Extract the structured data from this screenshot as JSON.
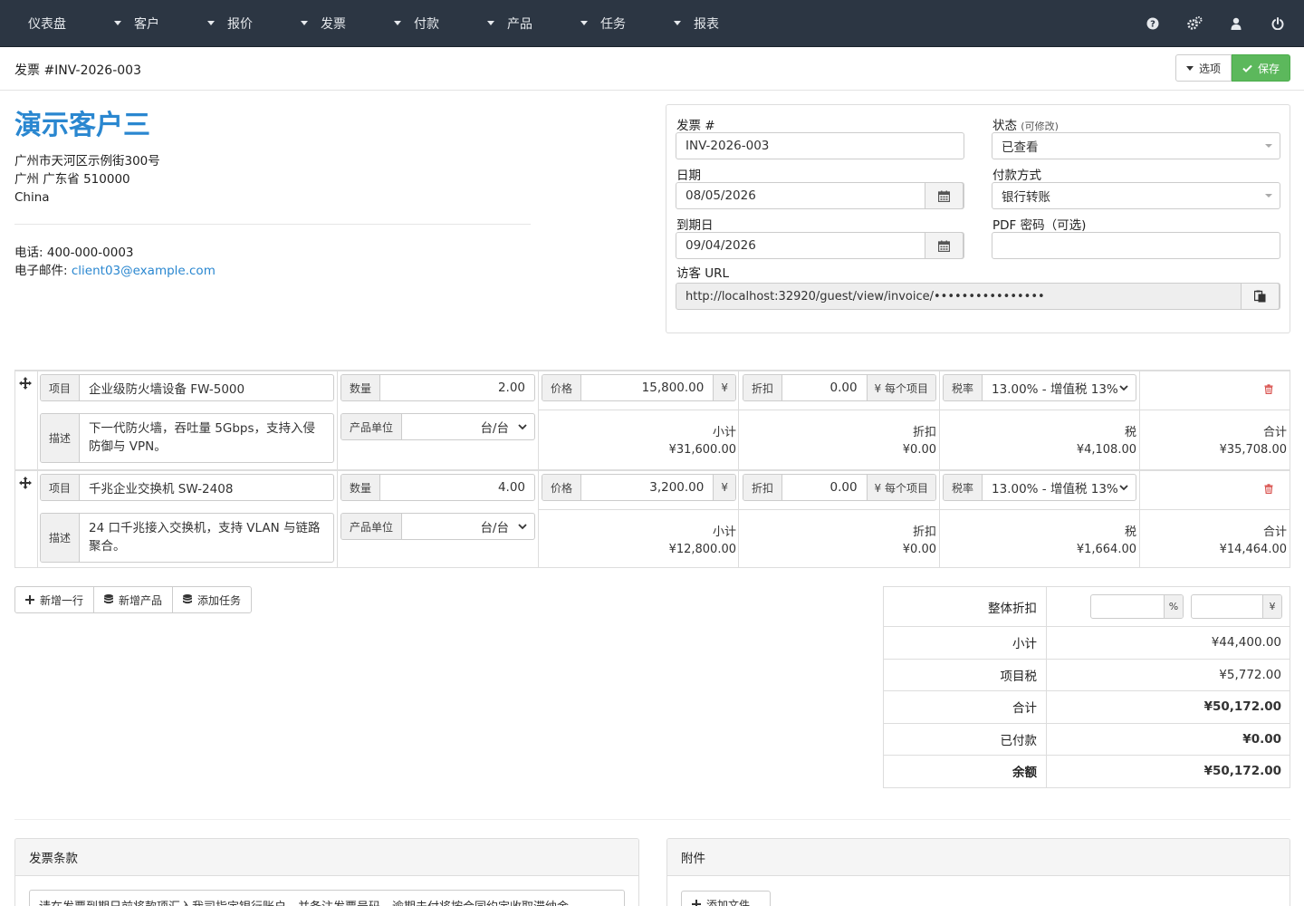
{
  "nav": {
    "items": [
      {
        "label": "仪表盘",
        "has_caret": false
      },
      {
        "label": "客户",
        "has_caret": true
      },
      {
        "label": "报价",
        "has_caret": true
      },
      {
        "label": "发票",
        "has_caret": true
      },
      {
        "label": "付款",
        "has_caret": true
      },
      {
        "label": "产品",
        "has_caret": true
      },
      {
        "label": "任务",
        "has_caret": true
      },
      {
        "label": "报表",
        "has_caret": true
      }
    ],
    "icons": [
      "question-icon",
      "cogs-icon",
      "user-icon",
      "power-icon"
    ],
    "bg_color": "#2c3643"
  },
  "header": {
    "title": "发票 #INV-2026-003",
    "options_label": "选项",
    "save_label": "保存"
  },
  "client": {
    "name": "演示客户三",
    "address_line1": "广州市天河区示例街300号",
    "address_line2": "广州 广东省 510000",
    "country": "China",
    "phone_label": "电话:",
    "phone": "400-000-0003",
    "email_label": "电子邮件:",
    "email": "client03@example.com"
  },
  "props": {
    "invoice_no_label": "发票 #",
    "invoice_no": "INV-2026-003",
    "date_label": "日期",
    "date": "08/05/2026",
    "due_label": "到期日",
    "due": "09/04/2026",
    "status_label": "状态",
    "status_hint": "(可修改)",
    "status": "已查看",
    "payment_label": "付款方式",
    "payment": "银行转账",
    "pdf_label": "PDF 密码（可选)",
    "pdf_password": "",
    "guest_label": "访客 URL",
    "guest_url": "http://localhost:32920/guest/view/invoice/••••••••••••••••"
  },
  "labels": {
    "item": "项目",
    "qty": "数量",
    "price": "价格",
    "discount": "折扣",
    "per_item": "¥ 每个项目",
    "tax_rate": "税率",
    "description": "描述",
    "unit": "产品单位",
    "subtotal": "小计",
    "disc_total": "折扣",
    "tax": "税",
    "total": "合计",
    "currency": "¥"
  },
  "items": [
    {
      "name": "企业级防火墙设备 FW-5000",
      "qty": "2.00",
      "price": "15,800.00",
      "discount": "0.00",
      "tax_rate": "13.00% - 增值税 13%",
      "description": "下一代防火墙，吞吐量 5Gbps，支持入侵防御与 VPN。",
      "unit": "台/台",
      "subtotal": "¥31,600.00",
      "disc": "¥0.00",
      "tax": "¥4,108.00",
      "total": "¥35,708.00"
    },
    {
      "name": "千兆企业交换机 SW-2408",
      "qty": "4.00",
      "price": "3,200.00",
      "discount": "0.00",
      "tax_rate": "13.00% - 增值税 13%",
      "description": "24 口千兆接入交换机，支持 VLAN 与链路聚合。",
      "unit": "台/台",
      "subtotal": "¥12,800.00",
      "disc": "¥0.00",
      "tax": "¥1,664.00",
      "total": "¥14,464.00"
    }
  ],
  "actions": {
    "add_row": "新增一行",
    "add_product": "新增产品",
    "add_task": "添加任务"
  },
  "totals": {
    "overall_discount_label": "整体折扣",
    "percent_suffix": "%",
    "currency_suffix": "¥",
    "subtotal_label": "小计",
    "subtotal": "¥44,400.00",
    "item_tax_label": "项目税",
    "item_tax": "¥5,772.00",
    "total_label": "合计",
    "total": "¥50,172.00",
    "paid_label": "已付款",
    "paid": "¥0.00",
    "balance_label": "余额",
    "balance": "¥50,172.00"
  },
  "terms": {
    "title": "发票条款",
    "text": "请在发票到期日前将款项汇入我司指定银行账户，并备注发票号码。逾期未付将按合同约定收取滞纳金。"
  },
  "attachments": {
    "title": "附件",
    "add_file": "添加文件..."
  },
  "colors": {
    "accent": "#2a87d0",
    "save": "#5cb85c",
    "danger": "#d9534f"
  }
}
